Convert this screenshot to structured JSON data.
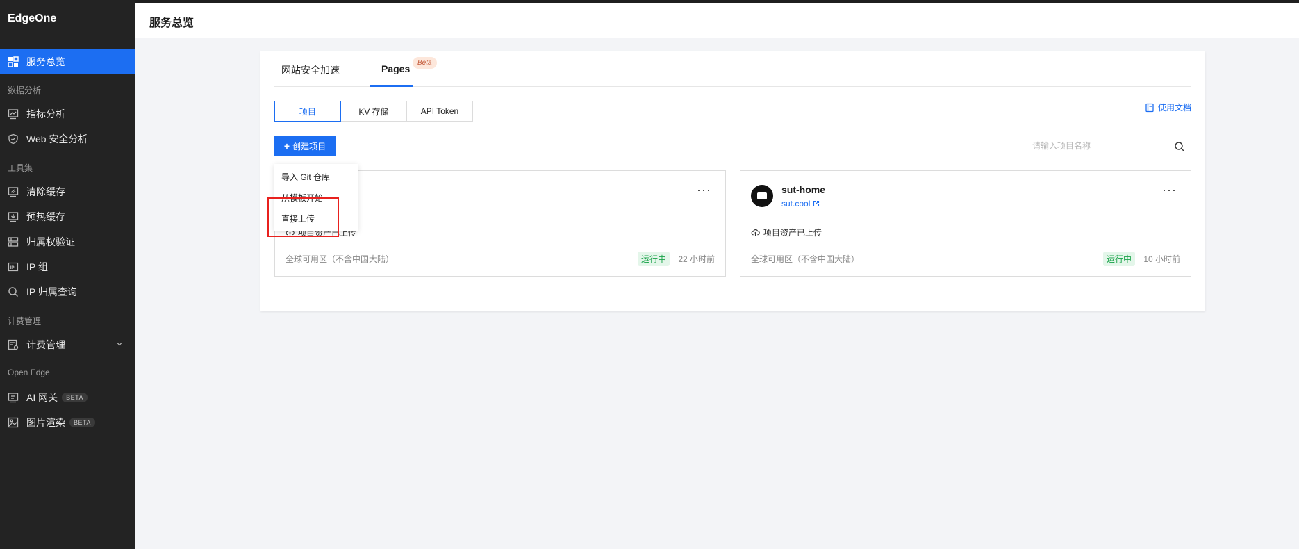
{
  "sidebar": {
    "brand": "EdgeOne",
    "active_item": "服务总览",
    "sections": {
      "data_analysis": "数据分析",
      "tools": "工具集",
      "billing": "计费管理",
      "open_edge": "Open Edge"
    },
    "items": {
      "overview": "服务总览",
      "metrics": "指标分析",
      "web_security": "Web 安全分析",
      "purge_cache": "清除缓存",
      "prefetch_cache": "预热缓存",
      "ownership": "归属权验证",
      "ip_group": "IP 组",
      "ip_lookup": "IP 归属查询",
      "billing": "计费管理",
      "ai_gateway": "AI 网关",
      "image_render": "图片渲染"
    },
    "beta_label": "BETA"
  },
  "header": {
    "title": "服务总览"
  },
  "tabs": {
    "items": [
      "网站安全加速",
      "Pages"
    ],
    "active": "Pages",
    "beta_badge": "Beta"
  },
  "segments": {
    "items": [
      "项目",
      "KV 存储",
      "API Token"
    ],
    "active": "项目"
  },
  "doc_link": "使用文档",
  "create_button": {
    "plus": "+",
    "label": "创建项目"
  },
  "search": {
    "placeholder": "请输入项目名称",
    "value": ""
  },
  "dropdown": {
    "items": [
      "导入 Git 仓库",
      "从模板开始",
      "直接上传"
    ],
    "highlighted": "直接上传"
  },
  "projects": [
    {
      "upload_text": "项目资产已上传",
      "region": "全球可用区（不含中国大陆）",
      "status": "运行中",
      "time": "22 小时前"
    },
    {
      "name": "sut-home",
      "domain": "sut.cool",
      "upload_text": "项目资产已上传",
      "region": "全球可用区（不含中国大陆）",
      "status": "运行中",
      "time": "10 小时前"
    }
  ],
  "more_label": "···",
  "colors": {
    "primary": "#1c6ef2",
    "sidebar_bg": "#232323",
    "status_green": "#1aa34a",
    "highlight_red": "#e8211e"
  },
  "icons": [
    "dashboard-icon",
    "chart-icon",
    "shield-icon",
    "purge-icon",
    "download-icon",
    "ownership-icon",
    "ip-icon",
    "search-icon",
    "billing-icon",
    "chevron-down-icon",
    "ai-gateway-icon",
    "image-icon",
    "book-icon",
    "cloud-upload-icon",
    "external-link-icon"
  ]
}
